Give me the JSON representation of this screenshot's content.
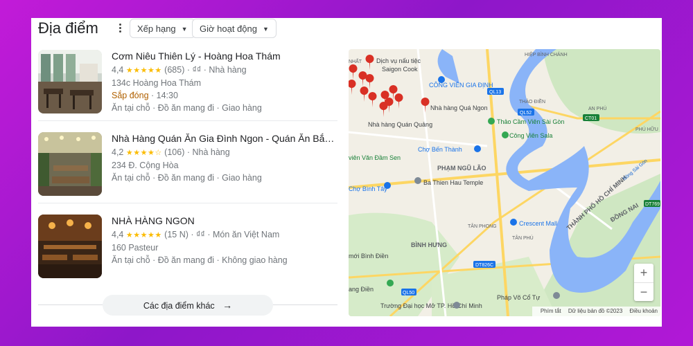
{
  "header": {
    "title": "Địa điểm",
    "filters": [
      {
        "label": "Xếp hạng"
      },
      {
        "label": "Giờ hoạt động"
      }
    ]
  },
  "places": [
    {
      "name": "Cơm Niêu Thiên Lý - Hoàng Hoa Thám",
      "rating": "4,4",
      "stars": "★★★★★",
      "reviews": "(685)",
      "price": "₫₫",
      "category": "Nhà hàng",
      "address": "134c Hoàng Hoa Thám",
      "status": "Sắp đóng",
      "status_time": "14:30",
      "services": "Ăn tại chỗ · Đồ ăn mang đi · Giao hàng"
    },
    {
      "name": "Nhà Hàng Quán Ăn Gia Đình Ngon - Quán Ăn Bắc Gần...",
      "rating": "4,2",
      "stars": "★★★★☆",
      "reviews": "(106)",
      "category": "Nhà hàng",
      "address": "234 Đ. Cộng Hòa",
      "services": "Ăn tại chỗ · Đồ ăn mang đi · Giao hàng"
    },
    {
      "name": "NHÀ HÀNG NGON",
      "rating": "4,4",
      "stars": "★★★★★",
      "reviews": "(15 N)",
      "price": "₫₫",
      "category": "Món ăn Việt Nam",
      "address": "160 Pasteur",
      "services": "Ăn tại chỗ · Đồ ăn mang đi · Không giao hàng"
    }
  ],
  "more_button": "Các địa điểm khác",
  "map": {
    "labels": {
      "cong_vien_gia_dinh": "CÔNG VIÊN GIA ĐỊNH",
      "dich_vu_nau_tiec": "Dịch vụ nấu tiệc",
      "saigon_cook": "Saigon Cook",
      "nha_hang_qua_ngon": "Nhà hàng Quá Ngon",
      "nha_hang_quan_quang": "Nhà hàng\nQuán Quảng",
      "thao_cam_vien": "Thảo Cầm Viên Sài Gòn",
      "cong_vien_sala": "Công Viên Sala",
      "cho_ben_thanh": "Chợ Bến Thành",
      "pham_ngu_lao": "PHẠM NGŨ LÃO",
      "vien_van_dam_sen": "viên Văn\nĐầm Sen",
      "cho_binh_tay": "Chợ Bình Tây",
      "ba_thien_hau": "Ba Thien Hau Temple",
      "tp_hcm": "THÀNH PHỐ HỒ CHÍ MINH",
      "dong_nai": "ĐỒNG NAI",
      "crescent_mall": "Crescent Mall",
      "tan_phong": "TÂN PHONG",
      "tan_phu": "TÂN PHÚ",
      "binh_hung": "BÌNH HƯNG",
      "cho_moi_binh_dien": "mới Bình Điền",
      "truong_dai_hoc": "Trường Đại học Mở TP.\nHồ Chí Minh",
      "phap_vo_co_tu": "Pháp Võ Cổ Tự",
      "thao_dien": "THẢO ĐIỀN",
      "an_phu": "AN PHÚ",
      "phu_huu": "PHÚ HỮU",
      "hiep_binh": "HIỆP BÌNH\nCHÁNH",
      "ql13": "QL13",
      "ql52": "QL52",
      "ct01": "CT01",
      "dt769": "DT769",
      "dt826c": "DT826C",
      "ql50": "QL50",
      "song_sai_gon": "Sông Sài Gòn",
      "nhat": "NHẤT",
      "ang_dien": "ang Điền"
    },
    "zoom_in": "+",
    "zoom_out": "−",
    "attribution": {
      "shortcuts": "Phím tắt",
      "data": "Dữ liệu bản đồ ©2023",
      "terms": "Điều khoản"
    }
  },
  "colors": {
    "star": "#fbbc04",
    "closing_soon": "#b06000",
    "pin_red": "#d93025",
    "park_green": "#34a853",
    "water": "#8ab4f8",
    "background_gradient": "#b118d6"
  }
}
